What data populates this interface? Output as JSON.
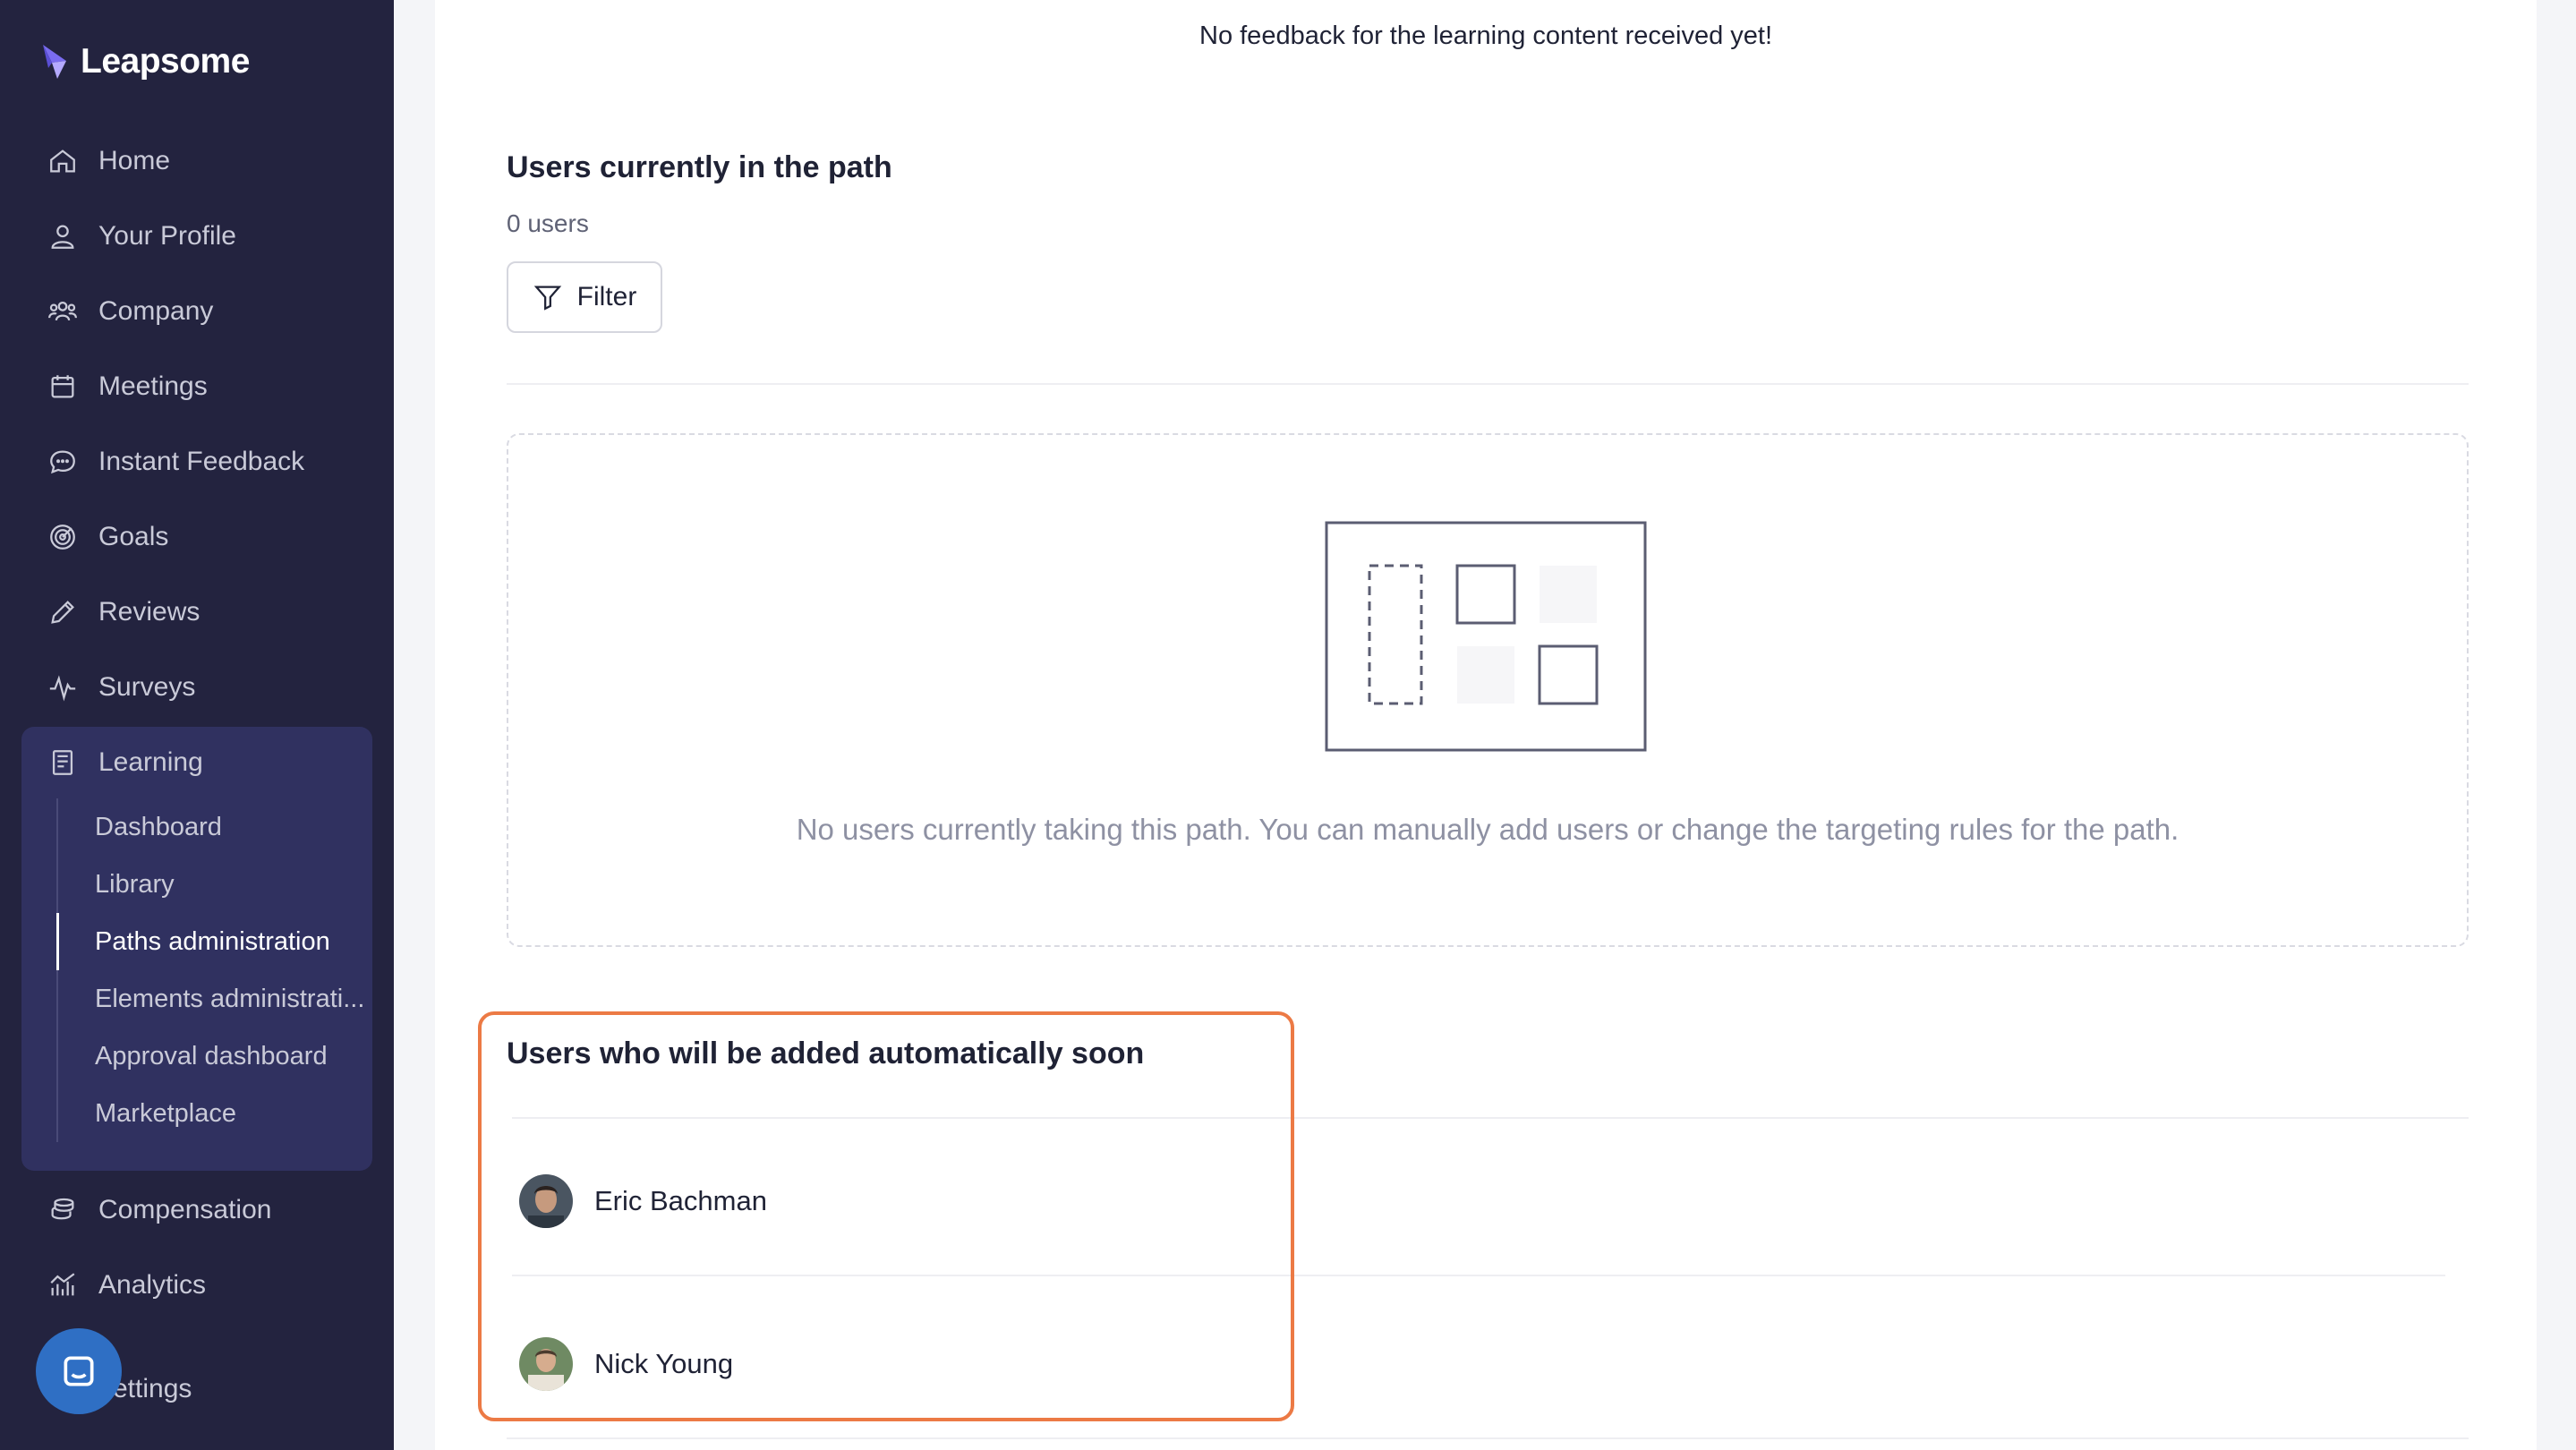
{
  "brand": {
    "name": "Leapsome"
  },
  "sidebar": {
    "items": [
      {
        "label": "Home",
        "icon": "home-icon"
      },
      {
        "label": "Your Profile",
        "icon": "user-icon"
      },
      {
        "label": "Company",
        "icon": "users-icon"
      },
      {
        "label": "Meetings",
        "icon": "calendar-icon"
      },
      {
        "label": "Instant Feedback",
        "icon": "chat-bubble-icon"
      },
      {
        "label": "Goals",
        "icon": "target-icon"
      },
      {
        "label": "Reviews",
        "icon": "pencil-icon"
      },
      {
        "label": "Surveys",
        "icon": "pulse-icon"
      },
      {
        "label": "Learning",
        "icon": "book-icon"
      },
      {
        "label": "Compensation",
        "icon": "coins-icon"
      },
      {
        "label": "Analytics",
        "icon": "chart-icon"
      },
      {
        "label": "Settings",
        "icon": "gear-icon"
      }
    ],
    "learning_sub": [
      {
        "label": "Dashboard"
      },
      {
        "label": "Library"
      },
      {
        "label": "Paths administration",
        "active": true
      },
      {
        "label": "Elements administrati..."
      },
      {
        "label": "Approval dashboard"
      },
      {
        "label": "Marketplace"
      }
    ],
    "settings_visible": "ettings"
  },
  "main": {
    "feedback_message": "No feedback for the learning content received yet!",
    "current_users": {
      "title": "Users currently in the path",
      "count": "0 users",
      "filter_label": "Filter",
      "empty_message": "No users currently taking this path. You can manually add users or change the targeting rules for the path."
    },
    "upcoming_users": {
      "title": "Users who will be added automatically soon",
      "users": [
        {
          "name": "Eric Bachman"
        },
        {
          "name": "Nick Young"
        }
      ]
    }
  },
  "colors": {
    "sidebar_bg": "#23233f",
    "sidebar_active_bg": "#303160",
    "accent_highlight": "#ec7a45",
    "chat_button": "#2f6fc4"
  }
}
